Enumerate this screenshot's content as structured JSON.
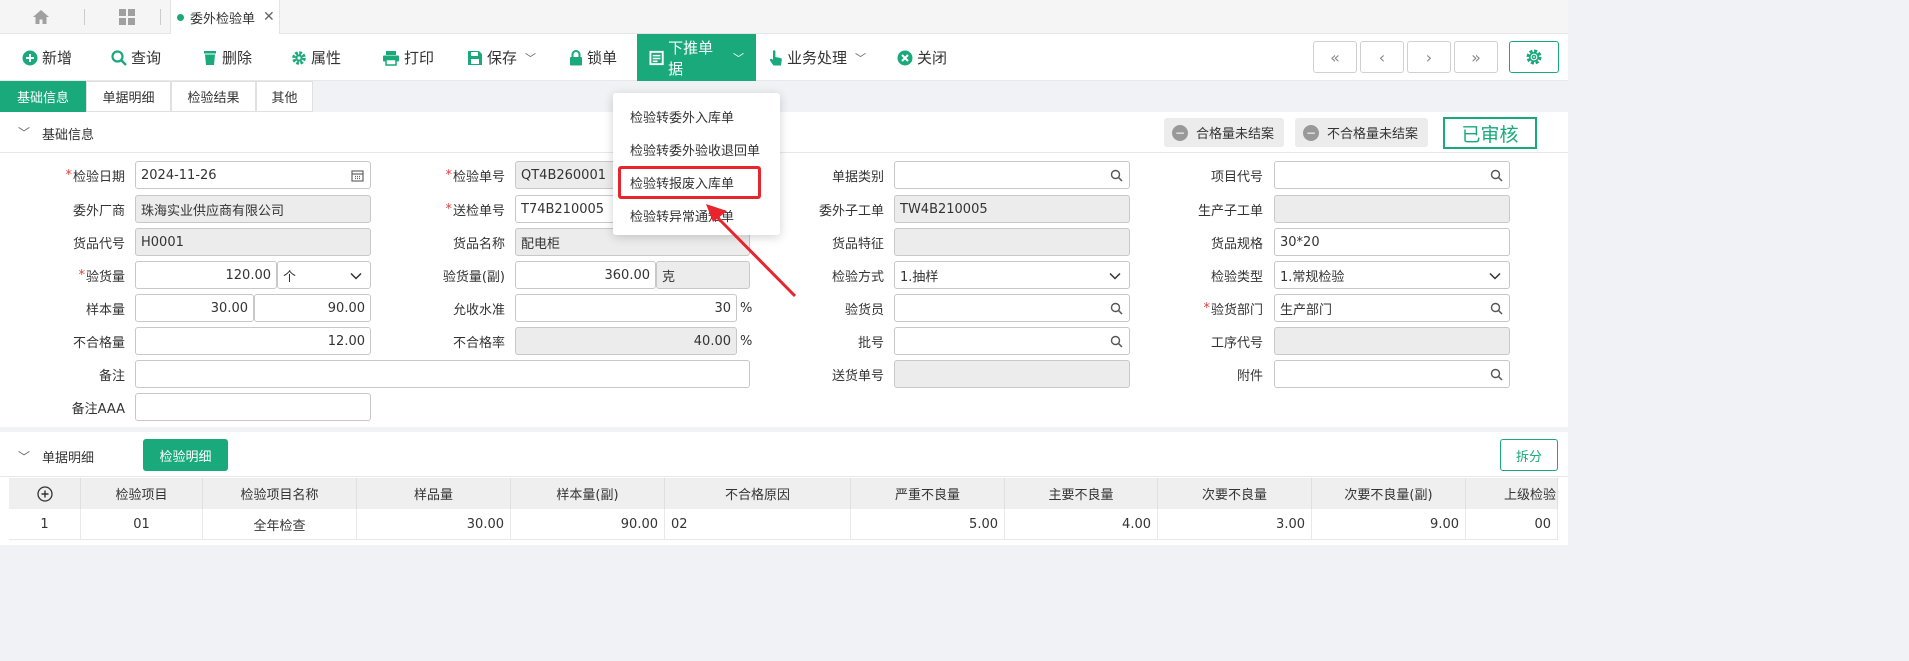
{
  "tabbar": {
    "tab_title": "委外检验单",
    "close": "✕"
  },
  "toolbar": {
    "add": "新增",
    "query": "查询",
    "delete": "删除",
    "props": "属性",
    "print": "打印",
    "save": "保存",
    "lock": "锁单",
    "push": "下推单据",
    "business": "业务处理",
    "close": "关闭",
    "nav_first": "«",
    "nav_prev": "‹",
    "nav_next": "›",
    "nav_last": "»"
  },
  "subtabs": [
    "基础信息",
    "单据明细",
    "检验结果",
    "其他"
  ],
  "section": {
    "title": "基础信息",
    "badge_pass": "合格量未结案",
    "badge_fail": "不合格量未结案",
    "audited": "已审核"
  },
  "form": {
    "inspect_date": {
      "label": "检验日期",
      "value": "2024-11-26"
    },
    "vendor": {
      "label": "委外厂商",
      "value": "珠海实业供应商有限公司"
    },
    "goods_code": {
      "label": "货品代号",
      "value": "H0001"
    },
    "inspect_qty": {
      "label": "验货量",
      "value": "120.00",
      "unit": "个"
    },
    "sample_qty": {
      "label": "样本量",
      "value": "30.00",
      "value2": "90.00"
    },
    "defect_qty": {
      "label": "不合格量",
      "value": "12.00"
    },
    "remark": {
      "label": "备注",
      "value": ""
    },
    "remark_aaa": {
      "label": "备注AAA",
      "value": ""
    },
    "inspect_no": {
      "label": "检验单号",
      "value": "QT4B260001"
    },
    "send_no": {
      "label": "送检单号",
      "value": "T74B210005"
    },
    "goods_name": {
      "label": "货品名称",
      "value": "配电柜"
    },
    "inspect_qty2": {
      "label": "验货量(副)",
      "value": "360.00",
      "unit": "克"
    },
    "accept_level": {
      "label": "允收水准",
      "value": "30",
      "pct": "%"
    },
    "defect_rate": {
      "label": "不合格率",
      "value": "40.00",
      "pct": "%"
    },
    "doc_type": {
      "label": "单据类别",
      "value": ""
    },
    "sub_work": {
      "label": "委外子工单",
      "value": "TW4B210005"
    },
    "goods_feature": {
      "label": "货品特征",
      "value": ""
    },
    "inspect_method": {
      "label": "检验方式",
      "value": "1.抽样"
    },
    "inspector": {
      "label": "验货员",
      "value": ""
    },
    "batch_no": {
      "label": "批号",
      "value": ""
    },
    "delivery_no": {
      "label": "送货单号",
      "value": ""
    },
    "project_code": {
      "label": "项目代号",
      "value": ""
    },
    "prod_sub_work": {
      "label": "生产子工单",
      "value": ""
    },
    "goods_spec": {
      "label": "货品规格",
      "value": "30*20"
    },
    "inspect_type": {
      "label": "检验类型",
      "value": "1.常规检验"
    },
    "inspect_dept": {
      "label": "验货部门",
      "value": "生产部门"
    },
    "process_code": {
      "label": "工序代号",
      "value": ""
    },
    "attachment": {
      "label": "附件",
      "value": ""
    }
  },
  "dropdown": {
    "items": [
      "检验转委外入库单",
      "检验转委外验收退回单",
      "检验转报废入库单",
      "检验转异常通知单"
    ]
  },
  "detail": {
    "title": "单据明细",
    "tab": "检验明细",
    "split": "拆分",
    "headers": [
      "检验项目",
      "检验项目名称",
      "样品量",
      "样本量(副)",
      "不合格原因",
      "严重不良量",
      "主要不良量",
      "次要不良量",
      "次要不良量(副)",
      "上级检验"
    ],
    "rows": [
      {
        "no": "1",
        "item": "01",
        "name": "全年检查",
        "sample": "30.00",
        "sample2": "90.00",
        "reason": "02",
        "severe": "5.00",
        "major": "4.00",
        "minor": "3.00",
        "minor2": "9.00",
        "parent": "00"
      }
    ]
  }
}
